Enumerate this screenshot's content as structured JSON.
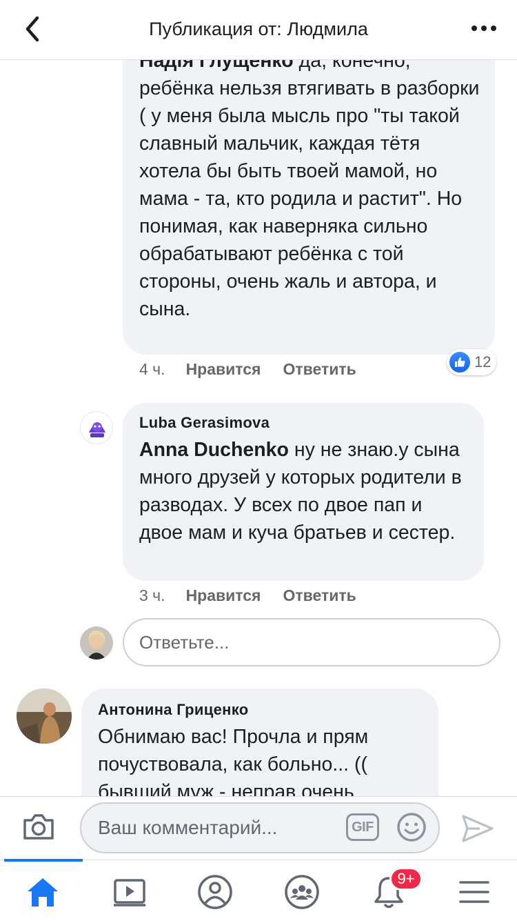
{
  "header": {
    "title": "Публикация от: Людмила",
    "back_icon": "chevron-left-icon",
    "more_icon": "more-horizontal-icon"
  },
  "comments": [
    {
      "mention": "Надія Глущенко",
      "text": " да, конечно, ребёнка нельзя втягивать в разборки ( у меня была мысль про \"ты такой славный мальчик, каждая тётя хотела бы быть твоей мамой, но мама - та, кто родила и растит\". Но понимая, как наверняка сильно обрабатывают ребёнка с той стороны, очень жаль и автора, и сына.",
      "time": "4 ч.",
      "like_label": "Нравится",
      "reply_label": "Ответить",
      "reaction_count": "12"
    },
    {
      "author": "Luba Gerasimova",
      "mention": "Anna Duchenko",
      "text": " ну не знаю.у сына много друзей у которых родители в разводах. У всех по двое пап и двое мам и куча братьев и сестер.",
      "time": "3 ч.",
      "like_label": "Нравится",
      "reply_label": "Ответить"
    },
    {
      "author": "Антонина Гриценко",
      "text": "Обнимаю вас! Прочла и прям почуствовала, как больно... (( бывший муж - неправ очень"
    }
  ],
  "reply_box": {
    "placeholder": "Ответьте..."
  },
  "composer": {
    "placeholder": "Ваш комментарий...",
    "gif_label": "GIF"
  },
  "tabbar": {
    "items": [
      "home-icon",
      "video-icon",
      "profile-icon",
      "groups-icon",
      "notifications-icon",
      "menu-icon"
    ],
    "active": "home-icon",
    "notifications_badge": "9+"
  },
  "colors": {
    "accent": "#1877f2",
    "bubble": "#f0f2f5",
    "secondary_text": "#65676b",
    "badge": "#f02849"
  }
}
